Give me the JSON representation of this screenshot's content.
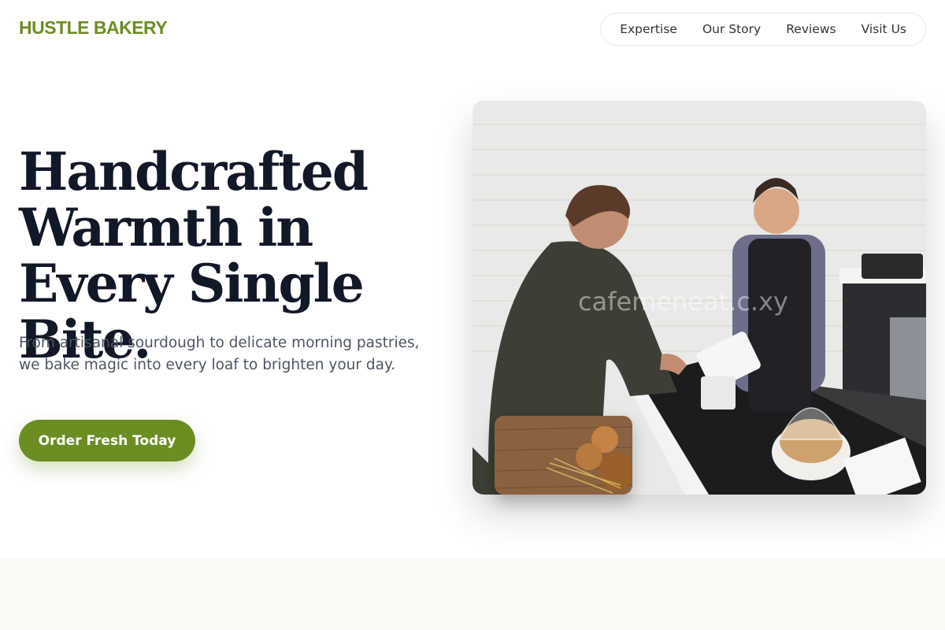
{
  "brand": {
    "name": "HUSTLE BAKERY",
    "color": "#6b8e23"
  },
  "nav": {
    "items": [
      {
        "label": "Expertise"
      },
      {
        "label": "Our Story"
      },
      {
        "label": "Reviews"
      },
      {
        "label": "Visit Us"
      }
    ]
  },
  "hero": {
    "title": "Handcrafted Warmth in Every Single Bite.",
    "subtitle": "From artisanal sourdough to delicate morning pastries, we bake magic into every loaf to brighten your day.",
    "cta_label": "Order Fresh Today",
    "main_image_icon": "bakery-counter-photo",
    "main_image_watermark": "cafemeneat.c.xy",
    "secondary_image_icon": "bread-loaves-photo"
  },
  "colors": {
    "accent": "#6b8e23",
    "heading": "#111827",
    "body_text": "#4b5563",
    "section_bg": "#f8faf6"
  }
}
